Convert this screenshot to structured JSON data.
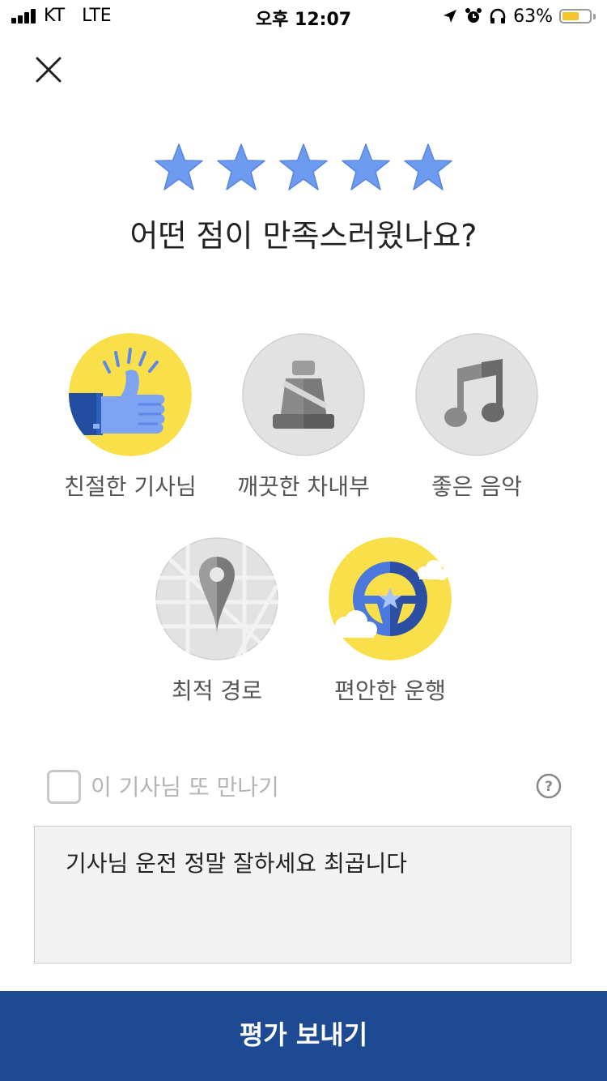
{
  "status_bar": {
    "carrier": "KT   LTE",
    "time": "오후 12:07",
    "battery_percent": "63%",
    "battery_level": 0.63,
    "icons": [
      "signal-icon",
      "location-icon",
      "alarm-icon",
      "headphones-icon",
      "battery-icon"
    ]
  },
  "header": {
    "close_icon": "close-icon"
  },
  "rating": {
    "stars": 5,
    "max": 5,
    "color": "#6c9bf0",
    "question": "어떤 점이 만족스러웠나요?"
  },
  "options": [
    {
      "label": "친절한 기사님",
      "icon": "thumbs-up-icon",
      "selected": true
    },
    {
      "label": "깨끗한 차내부",
      "icon": "car-seat-icon",
      "selected": false
    },
    {
      "label": "좋은 음악",
      "icon": "music-note-icon",
      "selected": false
    },
    {
      "label": "최적 경로",
      "icon": "map-pin-icon",
      "selected": false
    },
    {
      "label": "편안한 운행",
      "icon": "steering-wheel-icon",
      "selected": true
    }
  ],
  "rematch": {
    "label": "이 기사님 또 만나기",
    "checked": false,
    "help_icon": "help-icon"
  },
  "comment": {
    "value": "기사님 운전 정말 잘하세요 최곱니다"
  },
  "submit": {
    "label": "평가 보내기"
  },
  "colors": {
    "accent": "#1e4a93",
    "selected_bg": "#f9e04b",
    "unselected_bg": "#e2e2e2",
    "star": "#6c9bf0"
  }
}
